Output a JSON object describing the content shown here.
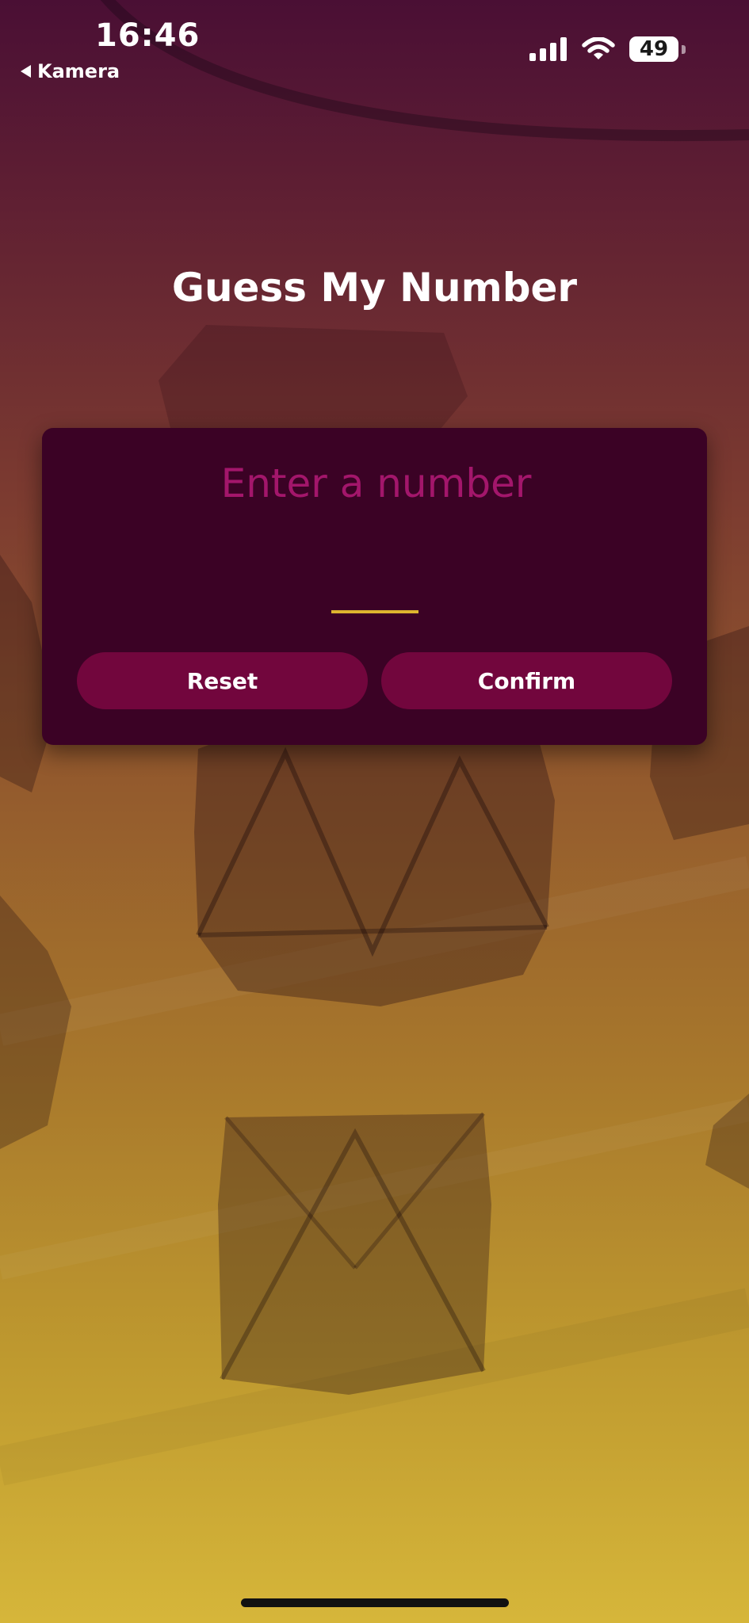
{
  "status_bar": {
    "time": "16:46",
    "back_label": "Kamera",
    "battery_level": "49",
    "icons": [
      "cellular-signal-icon",
      "wifi-icon",
      "battery-icon"
    ]
  },
  "game": {
    "title": "Guess My Number",
    "input_placeholder": "Enter a number",
    "input_value": "",
    "reset_label": "Reset",
    "confirm_label": "Confirm"
  },
  "colors": {
    "card_background": "#3b0225",
    "button_background": "#72063d",
    "placeholder_text": "#a3166b",
    "accent_underline": "#ddb52f",
    "title_text": "#ffffff"
  }
}
